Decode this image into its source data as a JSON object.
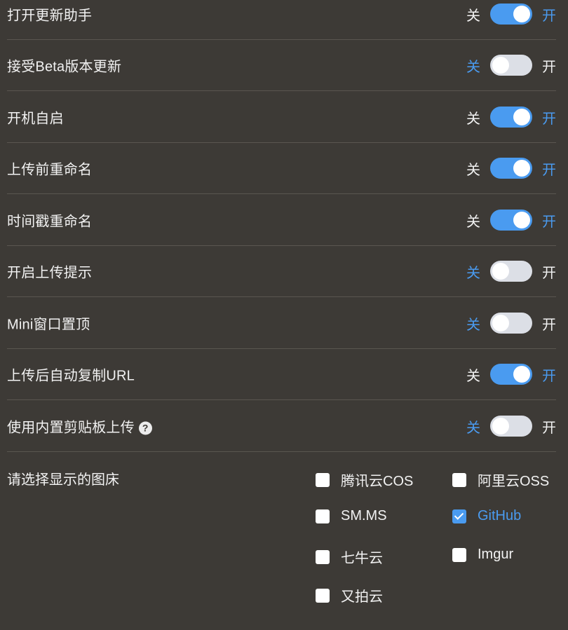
{
  "switches": [
    {
      "label": "打开更新助手",
      "off_text": "关",
      "on_text": "开",
      "state": "on"
    },
    {
      "label": "接受Beta版本更新",
      "off_text": "关",
      "on_text": "开",
      "state": "off"
    },
    {
      "label": "开机自启",
      "off_text": "关",
      "on_text": "开",
      "state": "on"
    },
    {
      "label": "上传前重命名",
      "off_text": "关",
      "on_text": "开",
      "state": "on"
    },
    {
      "label": "时间戳重命名",
      "off_text": "关",
      "on_text": "开",
      "state": "on"
    },
    {
      "label": "开启上传提示",
      "off_text": "关",
      "on_text": "开",
      "state": "off"
    },
    {
      "label": "Mini窗口置顶",
      "off_text": "关",
      "on_text": "开",
      "state": "off"
    },
    {
      "label": "上传后自动复制URL",
      "off_text": "关",
      "on_text": "开",
      "state": "on"
    },
    {
      "label": "使用内置剪贴板上传",
      "off_text": "关",
      "on_text": "开",
      "state": "off",
      "help_icon": "question-circle-icon"
    }
  ],
  "picbed": {
    "label": "请选择显示的图床",
    "options": [
      {
        "label": "腾讯云COS",
        "checked": false
      },
      {
        "label": "阿里云OSS",
        "checked": false
      },
      {
        "label": "SM.MS",
        "checked": false
      },
      {
        "label": "GitHub",
        "checked": true
      },
      {
        "label": "七牛云",
        "checked": false
      },
      {
        "label": "Imgur",
        "checked": false
      },
      {
        "label": "又拍云",
        "checked": false
      }
    ]
  },
  "colors": {
    "background": "#3d3a36",
    "accent": "#4a9bf0",
    "toggle_off": "#dcdfe6",
    "divider": "#5a5650"
  }
}
